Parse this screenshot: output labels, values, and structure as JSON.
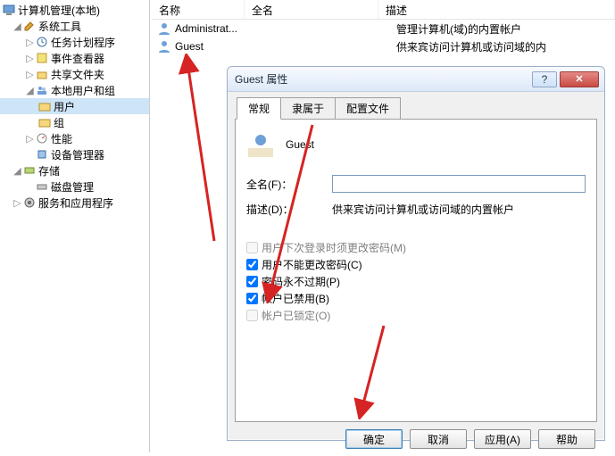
{
  "tree": {
    "root": "计算机管理(本地)",
    "systools": "系统工具",
    "tasksched": "任务计划程序",
    "eventviewer": "事件查看器",
    "sharedfolders": "共享文件夹",
    "localusers": "本地用户和组",
    "users": "用户",
    "groups": "组",
    "perf": "性能",
    "devmgr": "设备管理器",
    "storage": "存储",
    "diskmgmt": "磁盘管理",
    "servapps": "服务和应用程序"
  },
  "list": {
    "headers": {
      "name": "名称",
      "full": "全名",
      "desc": "描述"
    },
    "rows": [
      {
        "name": "Administrat...",
        "full": "",
        "desc": "管理计算机(域)的内置帐户"
      },
      {
        "name": "Guest",
        "full": "",
        "desc": "供来宾访问计算机或访问域的内"
      }
    ]
  },
  "dialog": {
    "title": "Guest 属性",
    "help": "?",
    "tabs": {
      "general": "常规",
      "memberof": "隶属于",
      "profile": "配置文件"
    },
    "username": "Guest",
    "fields": {
      "fullname_label": "全名(F)：",
      "fullname_value": "",
      "desc_label": "描述(D)：",
      "desc_value": "供来宾访问计算机或访问域的内置帐户"
    },
    "checks": {
      "mustchange": "用户下次登录时须更改密码(M)",
      "cannotchange": "用户不能更改密码(C)",
      "neverexpire": "密码永不过期(P)",
      "disabled": "帐户已禁用(B)",
      "locked": "帐户已锁定(O)"
    },
    "buttons": {
      "ok": "确定",
      "cancel": "取消",
      "apply": "应用(A)",
      "help": "帮助"
    }
  }
}
